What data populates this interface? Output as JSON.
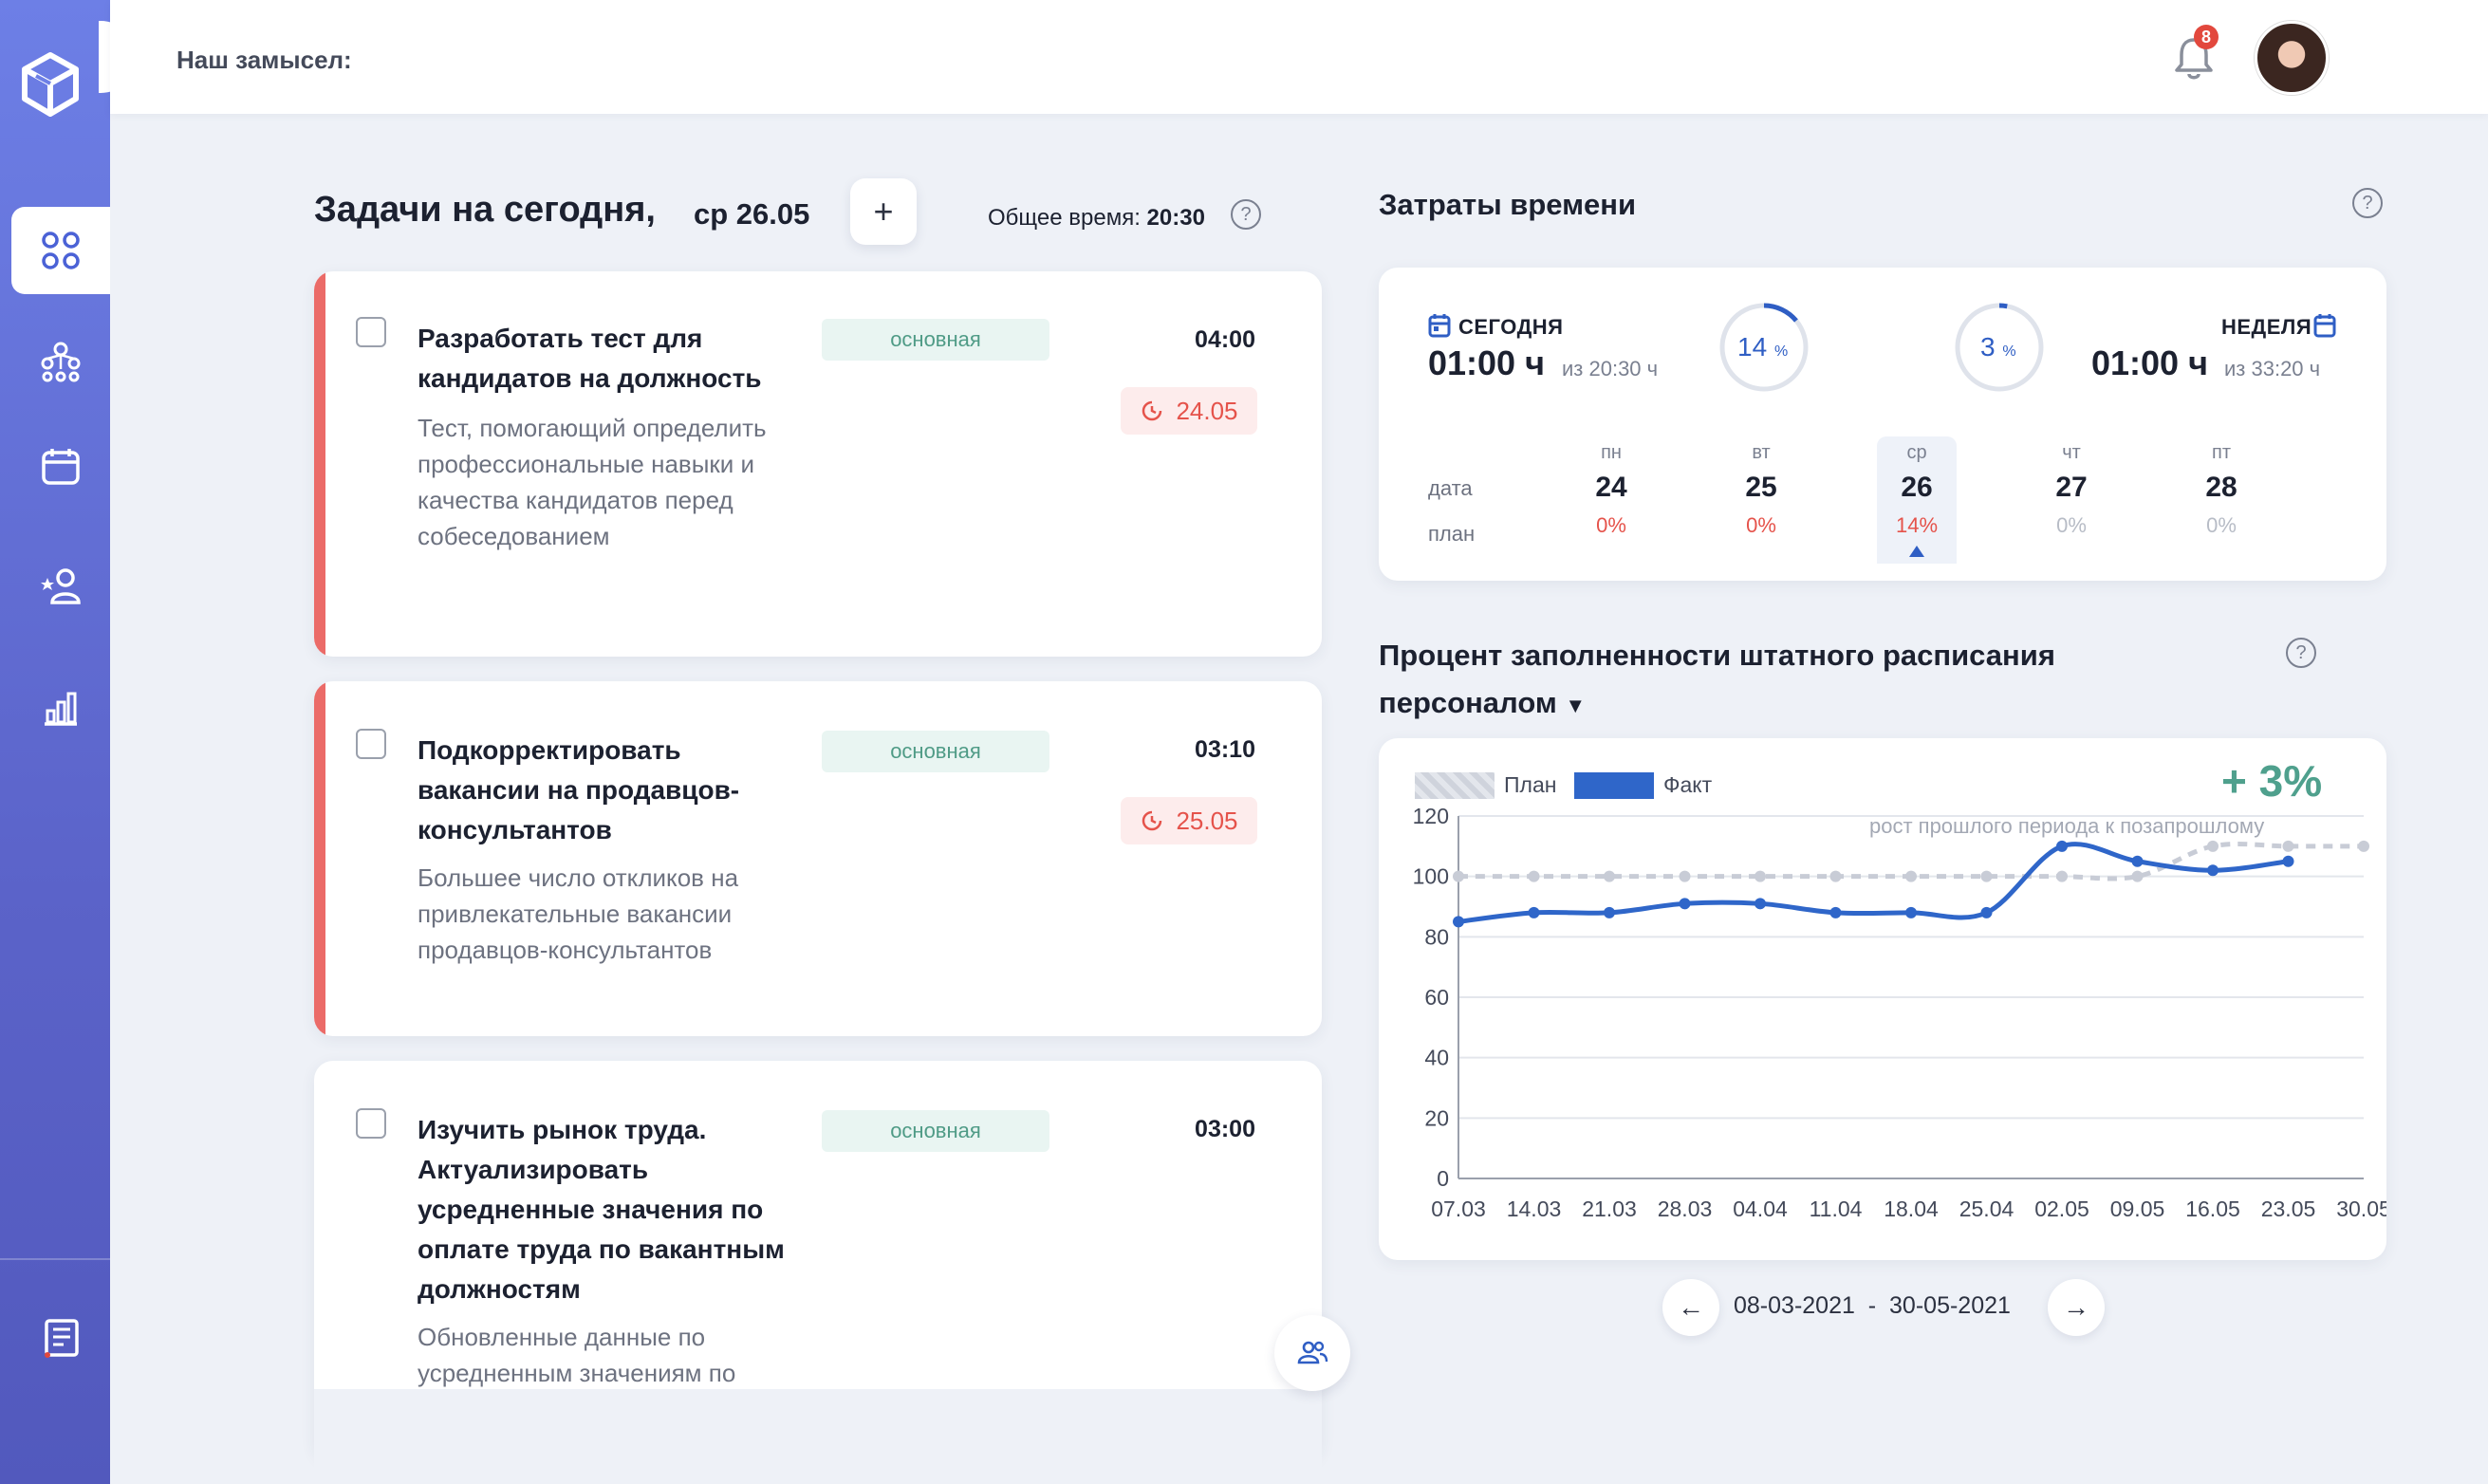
{
  "header": {
    "title": "Наш замысел:",
    "notifications_count": "8"
  },
  "tasks": {
    "title": "Задачи на сегодня,",
    "date": "ср 26.05",
    "add_label": "+",
    "total_label": "Общее время:",
    "total_value": "20:30",
    "items": [
      {
        "name": "Разработать тест для кандидатов на должность",
        "description": "Тест, помогающий определить профессиональные навыки и качества кандидатов перед собеседованием",
        "tag": "основная",
        "time": "04:00",
        "deadline": "24.05",
        "urgent": true
      },
      {
        "name": "Подкорректировать вакансии на продавцов-консультантов",
        "description": "Большее число откликов на привлекательные вакансии продавцов-консультантов",
        "tag": "основная",
        "time": "03:10",
        "deadline": "25.05",
        "urgent": true
      },
      {
        "name": "Изучить рынок труда. Актуализировать усредненные значения по оплате труда по вакантным должностям",
        "description": "Обновленные данные по усредненным значениям по",
        "tag": "основная",
        "time": "03:00",
        "deadline": "",
        "urgent": false
      }
    ]
  },
  "time_costs": {
    "title": "Затраты времени",
    "today_label": "СЕГОДНЯ",
    "today_value": "01:00 ч",
    "today_of": "из 20:30 ч",
    "today_percent": 14,
    "week_label": "НЕДЕЛЯ",
    "week_value": "01:00 ч",
    "week_of": "из 33:20 ч",
    "week_percent": 3,
    "percent_sign": "%",
    "row_date": "дата",
    "row_plan": "план",
    "days": [
      {
        "name": "пн",
        "date": "24",
        "pct": "0%",
        "color": "#e5534b"
      },
      {
        "name": "вт",
        "date": "25",
        "pct": "0%",
        "color": "#e5534b"
      },
      {
        "name": "ср",
        "date": "26",
        "pct": "14%",
        "color": "#e5534b"
      },
      {
        "name": "чт",
        "date": "27",
        "pct": "0%",
        "color": "#b7bcc6"
      },
      {
        "name": "пт",
        "date": "28",
        "pct": "0%",
        "color": "#b7bcc6"
      }
    ]
  },
  "staffing": {
    "title_line1": "Процент заполненности штатного расписания",
    "title_line2": "персоналом",
    "legend_plan": "План",
    "legend_fact": "Факт",
    "growth": "+ 3%",
    "growth_sub": "рост прошлого периода к позапрошлому",
    "range_from": "08-03-2021",
    "range_sep": "-",
    "range_to": "30-05-2021"
  },
  "chart_data": {
    "type": "line",
    "x": [
      "07.03",
      "14.03",
      "21.03",
      "28.03",
      "04.04",
      "11.04",
      "18.04",
      "25.04",
      "02.05",
      "09.05",
      "16.05",
      "23.05",
      "30.05"
    ],
    "ylim": [
      0,
      120
    ],
    "yticks": [
      0,
      20,
      40,
      60,
      80,
      100,
      120
    ],
    "grid": true,
    "series": [
      {
        "name": "План",
        "values": [
          100,
          100,
          100,
          100,
          100,
          100,
          100,
          100,
          100,
          100,
          110,
          110,
          110
        ],
        "color": "#c8ccd6",
        "dashed": true
      },
      {
        "name": "Факт",
        "values": [
          85,
          88,
          88,
          91,
          91,
          88,
          88,
          88,
          110,
          105,
          102,
          105,
          null
        ],
        "color": "#2f66c9",
        "dashed": false
      }
    ]
  },
  "colors": {
    "accent": "#2f66c9",
    "urgent": "#eb6b68",
    "growth": "#4fa08d",
    "sidebar": "#5b63c9"
  }
}
